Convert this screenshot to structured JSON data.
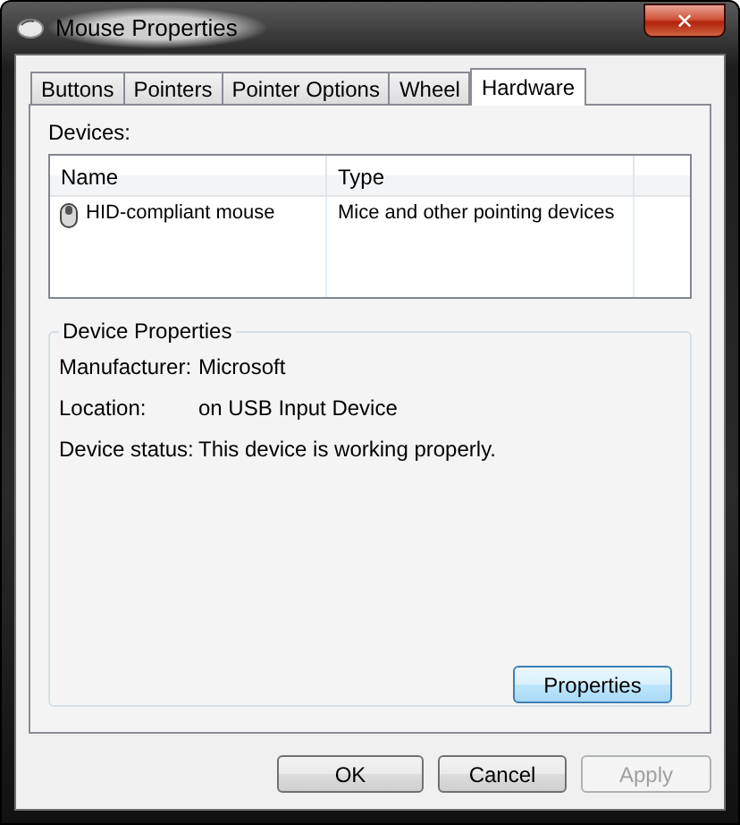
{
  "window": {
    "title": "Mouse Properties",
    "close": "✕"
  },
  "tabs": [
    {
      "label": "Buttons",
      "selected": false
    },
    {
      "label": "Pointers",
      "selected": false
    },
    {
      "label": "Pointer Options",
      "selected": false
    },
    {
      "label": "Wheel",
      "selected": false
    },
    {
      "label": "Hardware",
      "selected": true
    }
  ],
  "devices": {
    "label": "Devices:",
    "columns": [
      "Name",
      "Type"
    ],
    "rows": [
      {
        "name": "HID-compliant mouse",
        "type": "Mice and other pointing devices",
        "selected": false
      }
    ]
  },
  "device_properties": {
    "title": "Device Properties",
    "fields": [
      {
        "label": "Manufacturer:",
        "value": "Microsoft"
      },
      {
        "label": "Location:",
        "value": "on USB Input Device"
      },
      {
        "label": "Device status:",
        "value": "This device is working properly."
      }
    ],
    "button": {
      "label": "Properties",
      "focused": true
    }
  },
  "buttons": [
    {
      "label": "OK",
      "disabled": false
    },
    {
      "label": "Cancel",
      "disabled": false
    },
    {
      "label": "Apply",
      "disabled": true
    }
  ]
}
